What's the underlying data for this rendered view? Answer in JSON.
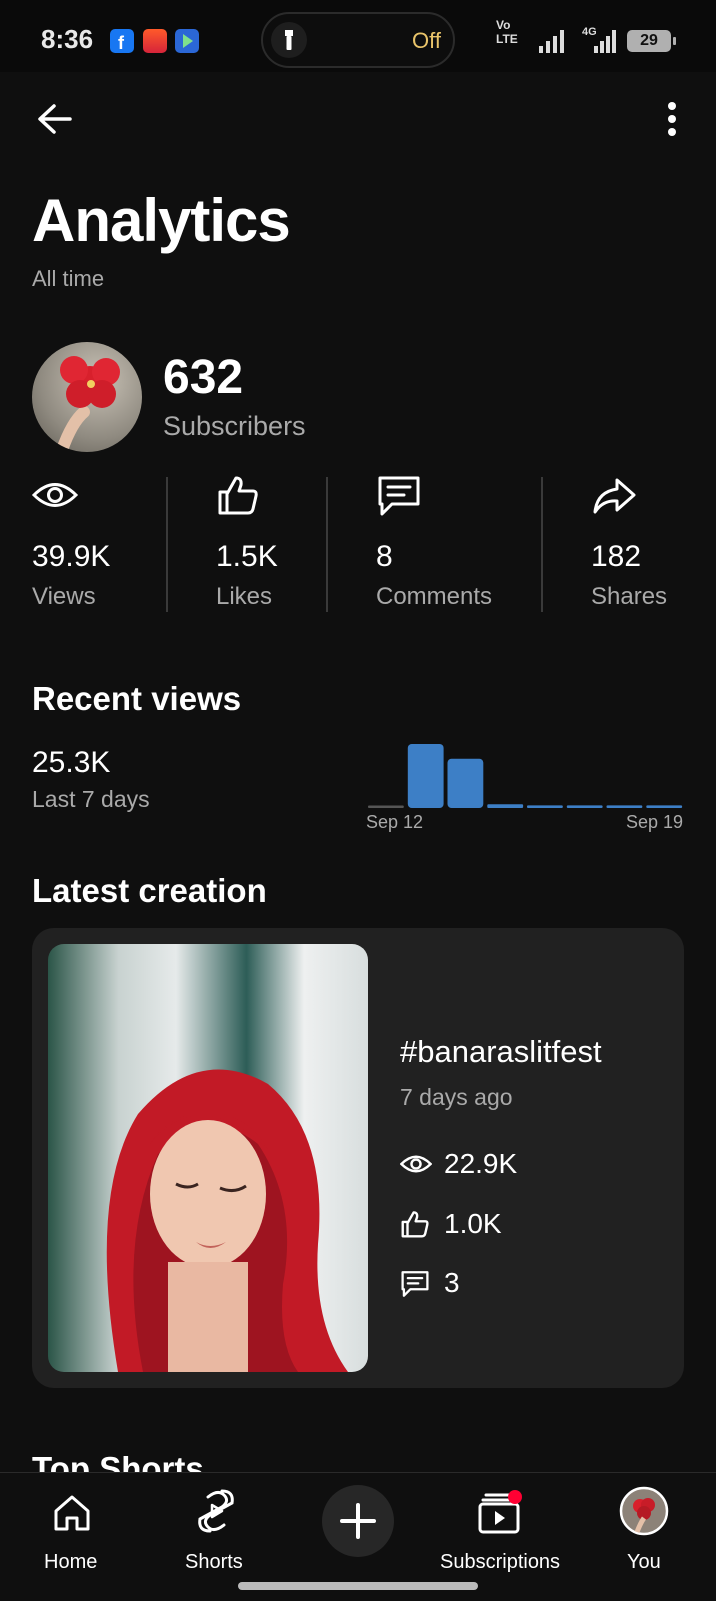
{
  "status_bar": {
    "time": "8:36",
    "torch_status": "Off",
    "network_vo": "Vo",
    "network_lte": "LTE",
    "network_4g": "4G",
    "battery": "29"
  },
  "header": {
    "title": "Analytics",
    "subtitle": "All time"
  },
  "channel": {
    "subscribers_count": "632",
    "subscribers_label": "Subscribers"
  },
  "stats": [
    {
      "icon": "eye-icon",
      "value": "39.9K",
      "label": "Views"
    },
    {
      "icon": "thumbs-up-icon",
      "value": "1.5K",
      "label": "Likes"
    },
    {
      "icon": "comment-icon",
      "value": "8",
      "label": "Comments"
    },
    {
      "icon": "share-icon",
      "value": "182",
      "label": "Shares"
    }
  ],
  "recent_views": {
    "heading": "Recent views",
    "value": "25.3K",
    "period": "Last 7 days"
  },
  "chart_data": {
    "type": "bar",
    "categories": [
      "",
      "",
      "",
      "",
      "",
      "",
      "",
      ""
    ],
    "values": [
      0,
      100,
      77,
      6,
      4,
      4,
      4,
      4
    ],
    "tick_labels": [
      "Sep 12",
      "Sep 19"
    ],
    "bar_color": "#3d7fc6",
    "grid": false
  },
  "latest_creation": {
    "heading": "Latest creation",
    "title": "#banaraslitfest",
    "age": "7 days ago",
    "views": "22.9K",
    "likes": "1.0K",
    "comments": "3"
  },
  "next_section": {
    "heading": "Top Shorts"
  },
  "bottom_nav": {
    "home": "Home",
    "shorts": "Shorts",
    "subscriptions": "Subscriptions",
    "you": "You"
  },
  "colors": {
    "background": "#0f0f0f",
    "card": "#212121",
    "accent_bar": "#3d7fc6",
    "notification_dot": "#ff0033",
    "torch_text": "#e9c46a"
  }
}
